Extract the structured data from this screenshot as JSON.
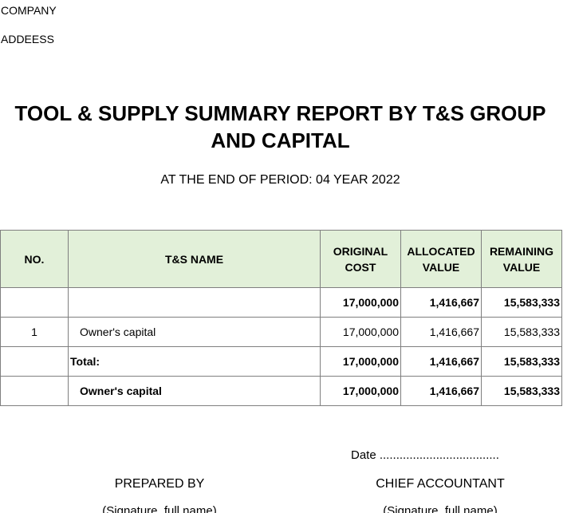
{
  "header": {
    "company": "COMPANY",
    "address": "ADDEESS"
  },
  "report": {
    "title": "TOOL & SUPPLY SUMMARY REPORT BY T&S GROUP AND CAPITAL",
    "period": "AT THE END OF PERIOD: 04 YEAR 2022"
  },
  "table": {
    "columns": {
      "no": "NO.",
      "name": "T&S NAME",
      "original_cost": "ORIGINAL COST",
      "allocated_value": "ALLOCATED VALUE",
      "remaining_value": "REMAINING VALUE"
    },
    "rows": [
      {
        "no": "",
        "name": "",
        "original_cost": "17,000,000",
        "allocated_value": "1,416,667",
        "remaining_value": "15,583,333"
      },
      {
        "no": "1",
        "name": "Owner's capital",
        "original_cost": "17,000,000",
        "allocated_value": "1,416,667",
        "remaining_value": "15,583,333"
      },
      {
        "no": "",
        "name": "Total:",
        "original_cost": "17,000,000",
        "allocated_value": "1,416,667",
        "remaining_value": "15,583,333"
      },
      {
        "no": "",
        "name": "Owner's capital",
        "original_cost": "17,000,000",
        "allocated_value": "1,416,667",
        "remaining_value": "15,583,333"
      }
    ]
  },
  "footer": {
    "date": "Date ....................................",
    "prepared_by": "PREPARED BY",
    "chief_accountant": "CHIEF ACCOUNTANT",
    "signature_left": "(Signature, full name)",
    "signature_right": "(Signature, full name)"
  }
}
